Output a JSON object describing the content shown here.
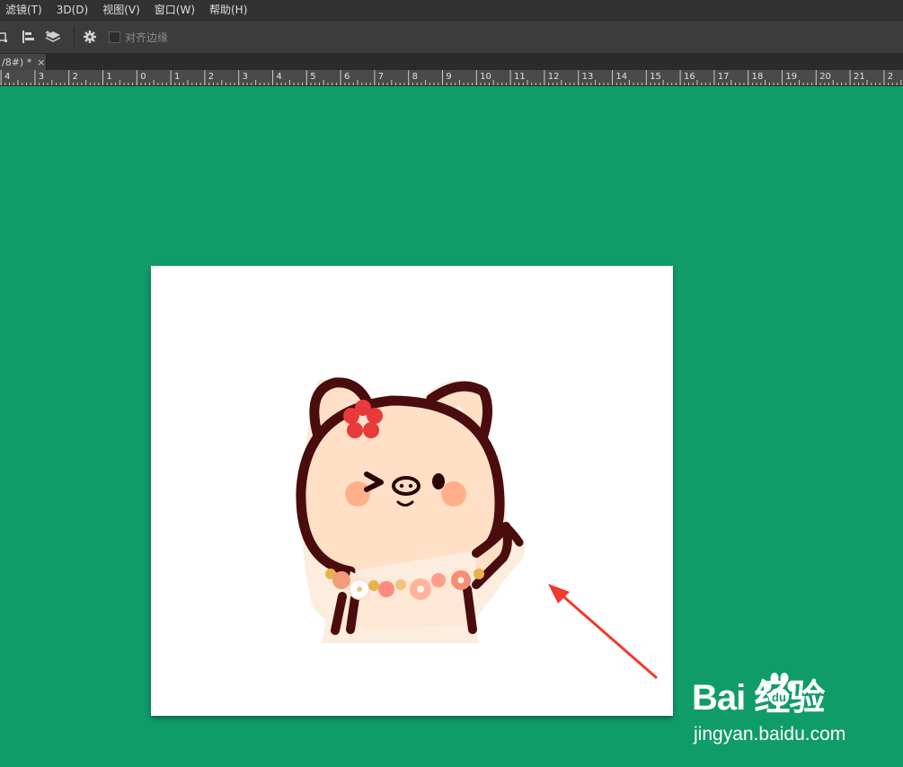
{
  "menu": [
    "滤镜(T)",
    "3D(D)",
    "视图(V)",
    "窗口(W)",
    "帮助(H)"
  ],
  "options_bar": {
    "align_edges_label": "对齐边缘",
    "align_edges_checked": false,
    "icons": [
      "transform-icon",
      "align-icon",
      "arrange-layers-icon",
      "gear-icon"
    ]
  },
  "document_tab": {
    "title": "/8#) *",
    "close_glyph": "×"
  },
  "ruler": {
    "labels": [
      "4",
      "3",
      "2",
      "1",
      "0",
      "1",
      "2",
      "3",
      "4",
      "5",
      "6",
      "7",
      "8",
      "9",
      "10",
      "11",
      "12",
      "13",
      "14",
      "15",
      "16",
      "17",
      "18",
      "19",
      "20",
      "21",
      "2"
    ]
  },
  "canvas_image": "pig-character-sticker",
  "annotation": {
    "arrow_color": "#f03a2e"
  },
  "watermark": {
    "logo": "Bai  经验",
    "url": "jingyan.baidu.com"
  },
  "colors": {
    "workspace": "#109c69",
    "menubar": "#323232",
    "optionsbar": "#3c3c3c",
    "ruler": "#4a4a4a"
  }
}
